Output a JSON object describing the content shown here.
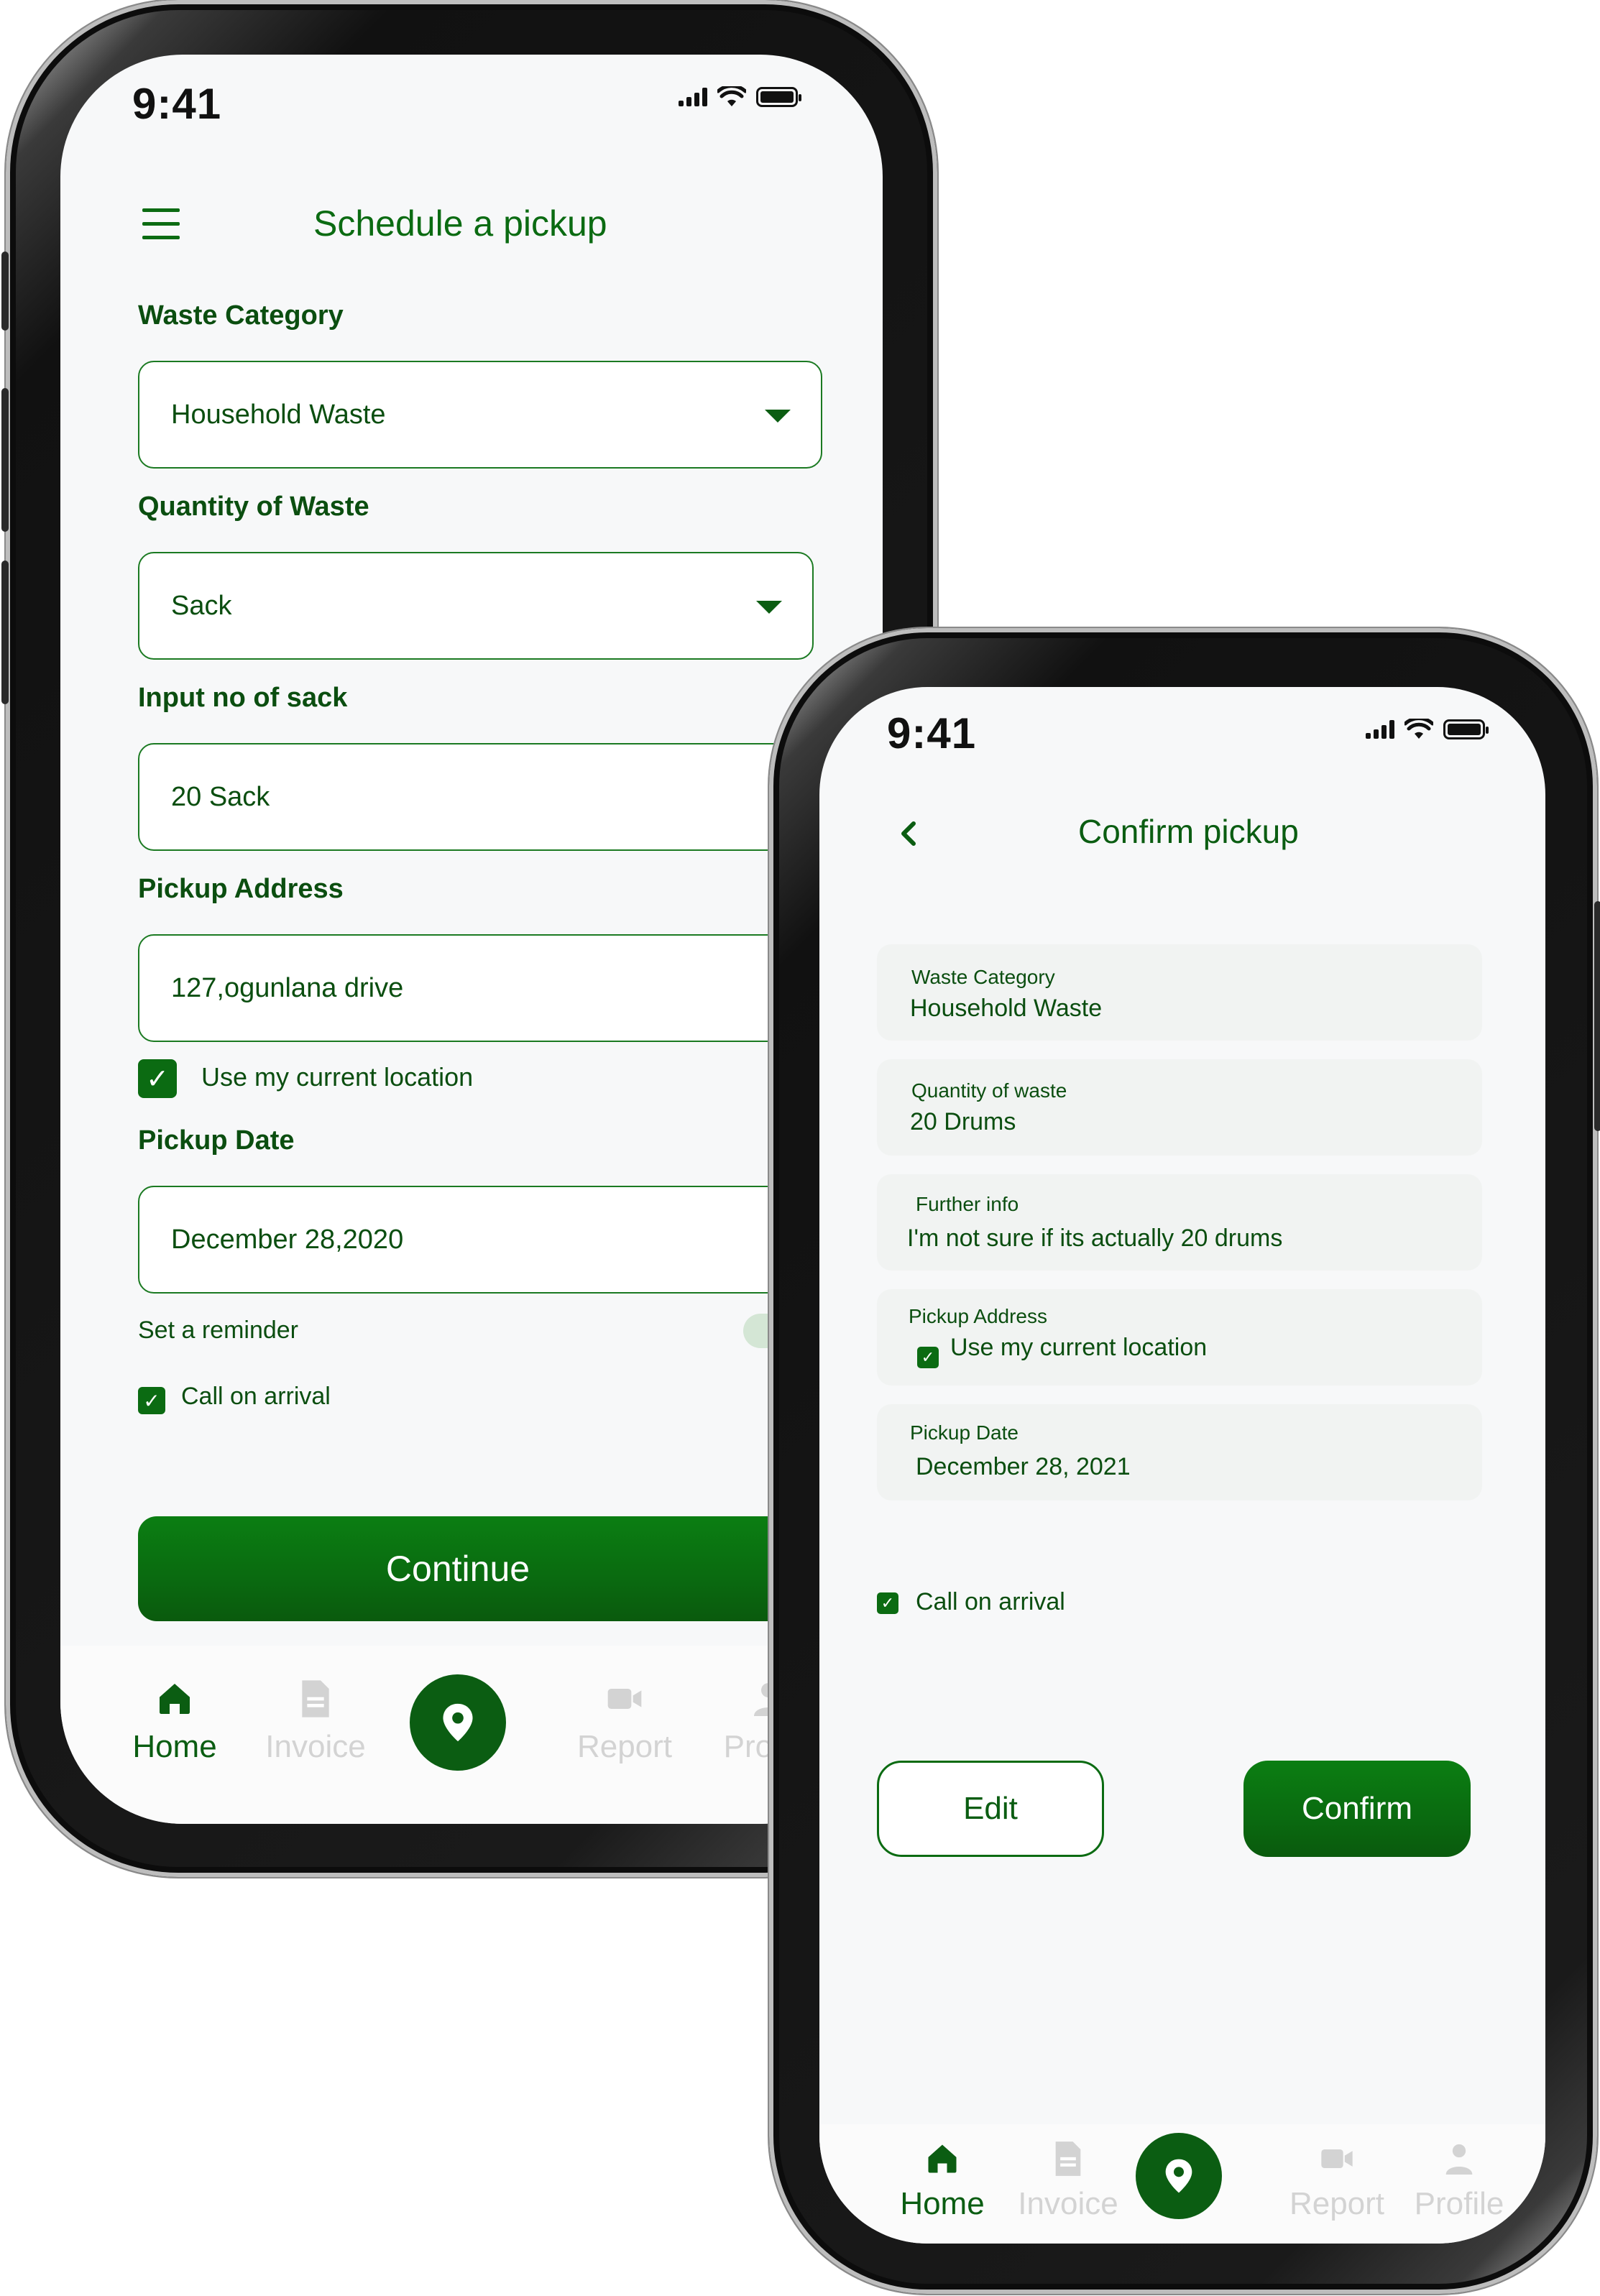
{
  "phone_left": {
    "status_time": "9:41",
    "title": "Schedule a pickup",
    "fields": {
      "waste_category_label": "Waste Category",
      "waste_category_value": "Household Waste",
      "quantity_label": "Quantity of  Waste",
      "quantity_value": "Sack",
      "sack_count_label": "Input no of sack",
      "sack_count_value": "20 Sack",
      "address_label": "Pickup Address",
      "address_value": "127,ogunlana drive",
      "use_location_label": "Use my current location",
      "use_location_checked": true,
      "date_label": "Pickup Date",
      "date_value": "December 28,2020",
      "reminder_label": "Set a reminder",
      "call_on_arrival_label": "Call on arrival",
      "call_on_arrival_checked": true
    },
    "continue_label": "Continue",
    "nav": {
      "home": "Home",
      "invoice": "Invoice",
      "report": "Report",
      "profile": "Profile"
    }
  },
  "phone_right": {
    "status_time": "9:41",
    "title": "Confirm pickup",
    "cards": [
      {
        "key": "Waste Category",
        "value": "Household Waste"
      },
      {
        "key": "Quantity of waste",
        "value": "20 Drums"
      },
      {
        "key": "Further info",
        "value": "I'm not sure if its actually 20 drums"
      },
      {
        "key": "Pickup Address",
        "value": "Use my current location"
      },
      {
        "key": "Pickup Date",
        "value": "December 28, 2021"
      }
    ],
    "call_on_arrival_label": "Call on arrival",
    "edit_label": "Edit",
    "confirm_label": "Confirm",
    "nav": {
      "home": "Home",
      "invoice": "Invoice",
      "report": "Report",
      "profile": "Profile"
    }
  },
  "colors": {
    "brand_green": "#0b5d12",
    "screen_bg": "#f7f8f9",
    "inactive_nav": "#d3d3d3"
  }
}
